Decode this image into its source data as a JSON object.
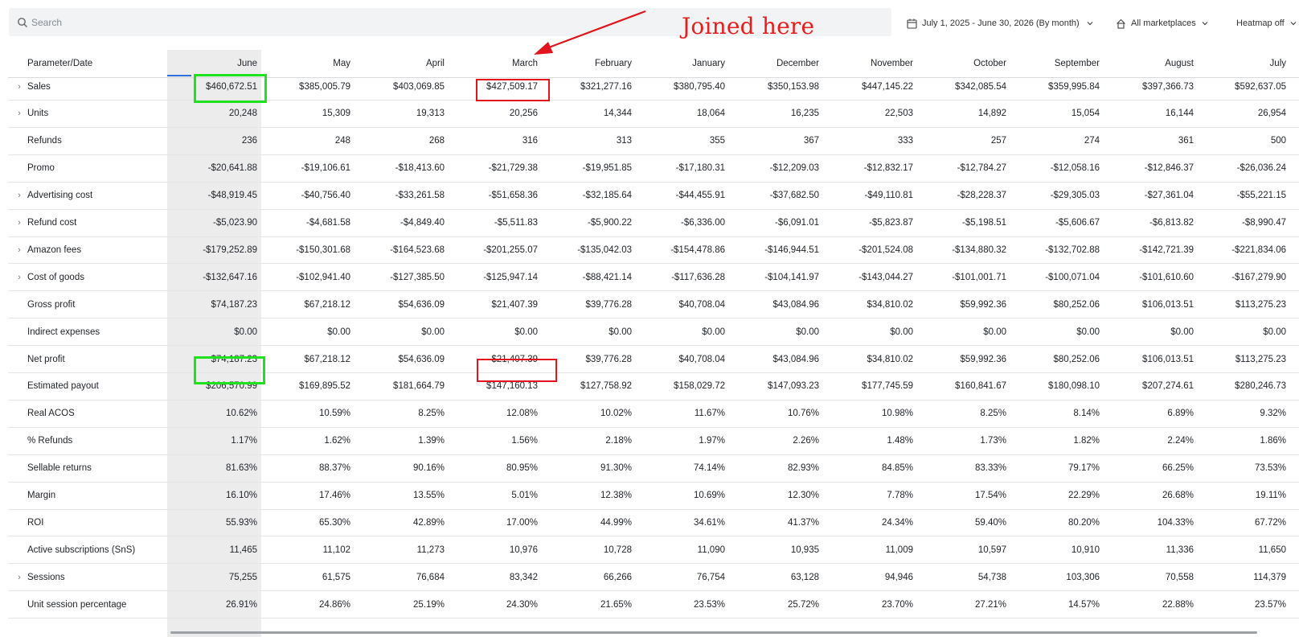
{
  "search": {
    "placeholder": "Search",
    "icon": "search-icon"
  },
  "filters": {
    "date_range": "July 1, 2025 - June 30, 2026 (By month)",
    "marketplace": "All marketplaces",
    "heatmap": "Heatmap off"
  },
  "annotation": {
    "text": "Joined here",
    "color": "#e81d1d"
  },
  "highlight_colors": {
    "green": "#1fe21f",
    "red": "#e3141b"
  },
  "table": {
    "header_label": "Parameter/Date",
    "columns": [
      "June",
      "May",
      "April",
      "March",
      "February",
      "January",
      "December",
      "November",
      "October",
      "September",
      "August",
      "July"
    ],
    "rows": [
      {
        "label": "Sales",
        "expandable": true,
        "values": [
          "$460,672.51",
          "$385,005.79",
          "$403,069.85",
          "$427,509.17",
          "$321,277.16",
          "$380,795.40",
          "$350,153.98",
          "$447,145.22",
          "$342,085.54",
          "$359,995.84",
          "$397,366.73",
          "$592,637.05"
        ]
      },
      {
        "label": "Units",
        "expandable": true,
        "values": [
          "20,248",
          "15,309",
          "19,313",
          "20,256",
          "14,344",
          "18,064",
          "16,235",
          "22,503",
          "14,892",
          "15,054",
          "16,144",
          "26,954"
        ]
      },
      {
        "label": "Refunds",
        "expandable": false,
        "values": [
          "236",
          "248",
          "268",
          "316",
          "313",
          "355",
          "367",
          "333",
          "257",
          "274",
          "361",
          "500"
        ]
      },
      {
        "label": "Promo",
        "expandable": false,
        "values": [
          "-$20,641.88",
          "-$19,106.61",
          "-$18,413.60",
          "-$21,729.38",
          "-$19,951.85",
          "-$17,180.31",
          "-$12,209.03",
          "-$12,832.17",
          "-$12,784.27",
          "-$12,058.16",
          "-$12,846.37",
          "-$26,036.24"
        ]
      },
      {
        "label": "Advertising cost",
        "expandable": true,
        "values": [
          "-$48,919.45",
          "-$40,756.40",
          "-$33,261.58",
          "-$51,658.36",
          "-$32,185.64",
          "-$44,455.91",
          "-$37,682.50",
          "-$49,110.81",
          "-$28,228.37",
          "-$29,305.03",
          "-$27,361.04",
          "-$55,221.15"
        ]
      },
      {
        "label": "Refund cost",
        "expandable": true,
        "values": [
          "-$5,023.90",
          "-$4,681.58",
          "-$4,849.40",
          "-$5,511.83",
          "-$5,900.22",
          "-$6,336.00",
          "-$6,091.01",
          "-$5,823.87",
          "-$5,198.51",
          "-$5,606.67",
          "-$6,813.82",
          "-$8,990.47"
        ]
      },
      {
        "label": "Amazon fees",
        "expandable": true,
        "values": [
          "-$179,252.89",
          "-$150,301.68",
          "-$164,523.68",
          "-$201,255.07",
          "-$135,042.03",
          "-$154,478.86",
          "-$146,944.51",
          "-$201,524.08",
          "-$134,880.32",
          "-$132,702.88",
          "-$142,721.39",
          "-$221,834.06"
        ]
      },
      {
        "label": "Cost of goods",
        "expandable": true,
        "values": [
          "-$132,647.16",
          "-$102,941.40",
          "-$127,385.50",
          "-$125,947.14",
          "-$88,421.14",
          "-$117,636.28",
          "-$104,141.97",
          "-$143,044.27",
          "-$101,001.71",
          "-$100,071.04",
          "-$101,610.60",
          "-$167,279.90"
        ]
      },
      {
        "label": "Gross profit",
        "expandable": false,
        "values": [
          "$74,187.23",
          "$67,218.12",
          "$54,636.09",
          "$21,407.39",
          "$39,776.28",
          "$40,708.04",
          "$43,084.96",
          "$34,810.02",
          "$59,992.36",
          "$80,252.06",
          "$106,013.51",
          "$113,275.23"
        ]
      },
      {
        "label": "Indirect expenses",
        "expandable": false,
        "values": [
          "$0.00",
          "$0.00",
          "$0.00",
          "$0.00",
          "$0.00",
          "$0.00",
          "$0.00",
          "$0.00",
          "$0.00",
          "$0.00",
          "$0.00",
          "$0.00"
        ]
      },
      {
        "label": "Net profit",
        "expandable": false,
        "values": [
          "$74,187.23",
          "$67,218.12",
          "$54,636.09",
          "$21,407.39",
          "$39,776.28",
          "$40,708.04",
          "$43,084.96",
          "$34,810.02",
          "$59,992.36",
          "$80,252.06",
          "$106,013.51",
          "$113,275.23"
        ]
      },
      {
        "label": "Estimated payout",
        "expandable": false,
        "values": [
          "$206,570.99",
          "$169,895.52",
          "$181,664.79",
          "$147,160.13",
          "$127,758.92",
          "$158,029.72",
          "$147,093.23",
          "$177,745.59",
          "$160,841.67",
          "$180,098.10",
          "$207,274.61",
          "$280,246.73"
        ]
      },
      {
        "label": "Real ACOS",
        "expandable": false,
        "values": [
          "10.62%",
          "10.59%",
          "8.25%",
          "12.08%",
          "10.02%",
          "11.67%",
          "10.76%",
          "10.98%",
          "8.25%",
          "8.14%",
          "6.89%",
          "9.32%"
        ]
      },
      {
        "label": "% Refunds",
        "expandable": false,
        "values": [
          "1.17%",
          "1.62%",
          "1.39%",
          "1.56%",
          "2.18%",
          "1.97%",
          "2.26%",
          "1.48%",
          "1.73%",
          "1.82%",
          "2.24%",
          "1.86%"
        ]
      },
      {
        "label": "Sellable returns",
        "expandable": false,
        "values": [
          "81.63%",
          "88.37%",
          "90.16%",
          "80.95%",
          "91.30%",
          "74.14%",
          "82.93%",
          "84.85%",
          "83.33%",
          "79.17%",
          "66.25%",
          "73.53%"
        ]
      },
      {
        "label": "Margin",
        "expandable": false,
        "values": [
          "16.10%",
          "17.46%",
          "13.55%",
          "5.01%",
          "12.38%",
          "10.69%",
          "12.30%",
          "7.78%",
          "17.54%",
          "22.29%",
          "26.68%",
          "19.11%"
        ]
      },
      {
        "label": "ROI",
        "expandable": false,
        "values": [
          "55.93%",
          "65.30%",
          "42.89%",
          "17.00%",
          "44.99%",
          "34.61%",
          "41.37%",
          "24.34%",
          "59.40%",
          "80.20%",
          "104.33%",
          "67.72%"
        ]
      },
      {
        "label": "Active subscriptions (SnS)",
        "expandable": false,
        "values": [
          "11,465",
          "11,102",
          "11,273",
          "10,976",
          "10,728",
          "11,090",
          "10,935",
          "11,009",
          "10,597",
          "10,910",
          "11,336",
          "11,650"
        ]
      },
      {
        "label": "Sessions",
        "expandable": true,
        "values": [
          "75,255",
          "61,575",
          "76,684",
          "83,342",
          "66,266",
          "76,754",
          "63,128",
          "94,946",
          "54,738",
          "103,306",
          "70,558",
          "114,379"
        ]
      },
      {
        "label": "Unit session percentage",
        "expandable": false,
        "values": [
          "26.91%",
          "24.86%",
          "25.19%",
          "24.30%",
          "21.65%",
          "23.53%",
          "25.72%",
          "23.70%",
          "27.21%",
          "14.57%",
          "22.88%",
          "23.57%"
        ]
      }
    ]
  }
}
